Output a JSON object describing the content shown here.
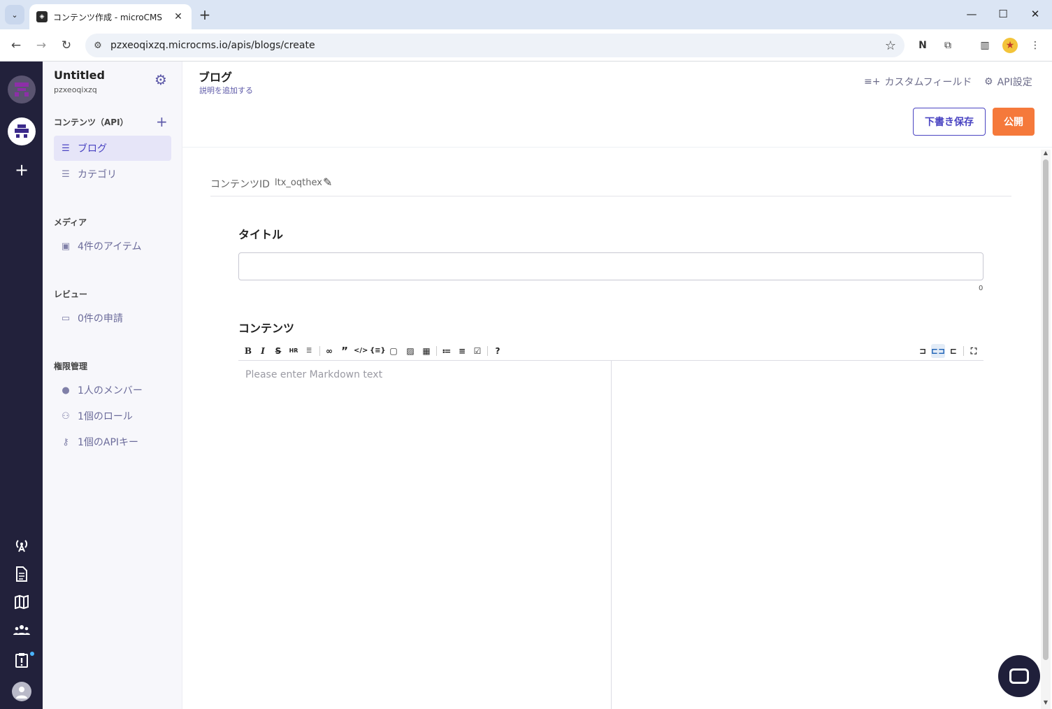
{
  "browser": {
    "tab_title": "コンテンツ作成 - microCMS",
    "url": "pzxeoqixzq.microcms.io/apis/blogs/create"
  },
  "service": {
    "name": "Untitled",
    "id": "pzxeoqixzq"
  },
  "sidebar": {
    "content_section": "コンテンツ（API）",
    "content_items": [
      {
        "label": "ブログ",
        "icon": "list-icon",
        "active": true
      },
      {
        "label": "カテゴリ",
        "icon": "list-icon",
        "active": false
      }
    ],
    "media_section": "メディア",
    "media_item": "4件のアイテム",
    "review_section": "レビュー",
    "review_item": "0件の申請",
    "permission_section": "権限管理",
    "permission_items": [
      {
        "label": "1人のメンバー",
        "icon": "person-icon"
      },
      {
        "label": "1個のロール",
        "icon": "group-icon"
      },
      {
        "label": "1個のAPIキー",
        "icon": "key-icon"
      }
    ]
  },
  "header": {
    "title": "ブログ",
    "description": "説明を追加する",
    "custom_field": "カスタムフィールド",
    "api_settings": "API設定",
    "draft_button": "下書き保存",
    "publish_button": "公開"
  },
  "form": {
    "content_id_label": "コンテンツID",
    "content_id_value": "ltx_oqthex",
    "title_label": "タイトル",
    "title_value": "",
    "title_count": "0",
    "content_label": "コンテンツ",
    "editor_placeholder": "Please enter Markdown text"
  },
  "colors": {
    "rail": "#22213b",
    "accent": "#4a44c2",
    "publish": "#f5793b"
  }
}
